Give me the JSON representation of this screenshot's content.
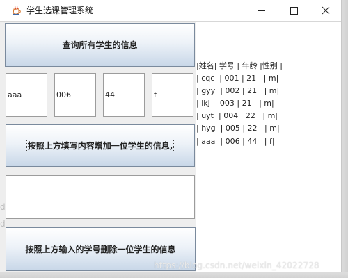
{
  "window": {
    "title": "学生选课管理系统"
  },
  "icons": {
    "app": "java-cup-icon",
    "minimize": "minimize-icon",
    "maximize": "maximize-icon",
    "close": "close-icon"
  },
  "buttons": {
    "query_label": "查询所有学生的信息",
    "add_label": "按照上方填写内容增加一位学生的信息,",
    "delete_label": "按照上方输入的学号删除一位学生的信息"
  },
  "inputs": {
    "name_value": "aaa",
    "id_value": "006",
    "age_value": "44",
    "sex_value": "f",
    "delete_id_value": ""
  },
  "info_panel": {
    "text": "|姓名| 学号 | 年龄 |性别 |\n| cqc  | 001 | 21   | m|\n| gyy  | 002 | 21   | m|\n| lkj  | 003 | 21   | m|\n| uyt  | 004 | 22   | m|\n| hyg  | 005 | 22   | m|\n| aaa  | 006 | 44   | f|"
  },
  "watermark": {
    "text": "https://blog.csdn.net/weixin_42022728"
  },
  "edge_marks": {
    "first": "d",
    "second": "d"
  },
  "colors": {
    "button_border": "#7a8a9d",
    "button_gradient_bottom": "#c8d7e8",
    "panel_background": "#eeeeee"
  }
}
